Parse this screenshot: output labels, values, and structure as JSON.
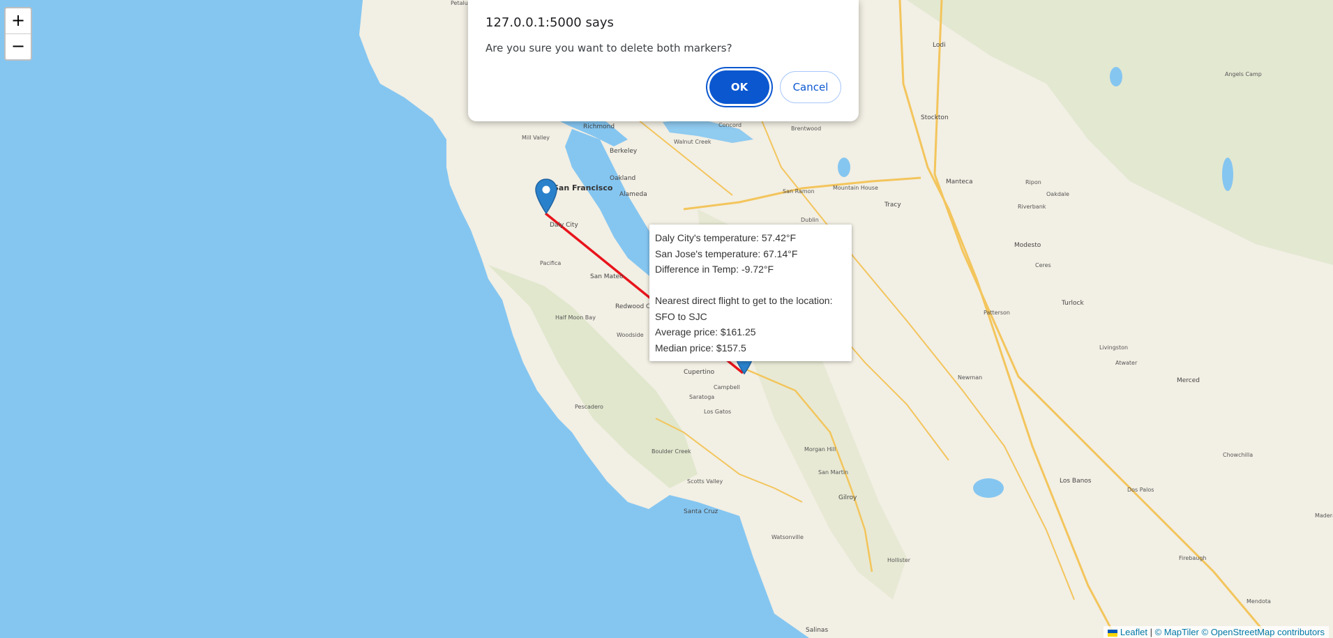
{
  "dialog": {
    "title": "127.0.0.1:5000 says",
    "message": "Are you sure you want to delete both markers?",
    "ok_label": "OK",
    "cancel_label": "Cancel"
  },
  "zoom": {
    "in_label": "+",
    "out_label": "−"
  },
  "popup": {
    "lines": [
      "Daly City's temperature: 57.42°F",
      "San Jose's temperature: 67.14°F",
      "Difference in Temp: -9.72°F",
      "",
      "Nearest direct flight to get to the location:",
      "SFO to SJC",
      "Average price: $161.25",
      "Median price: $157.5"
    ]
  },
  "attribution": {
    "leaflet": "Leaflet",
    "separator": "|",
    "maptiler": "© MapTiler",
    "osm": "© OpenStreetMap contributors"
  },
  "places": {
    "petaluma": "Petaluma Creek",
    "lodi": "Lodi",
    "stockton": "Stockton",
    "richmond": "Richmond",
    "berkeley": "Berkeley",
    "oakland": "Oakland",
    "alameda": "Alameda",
    "san_francisco": "San Francisco",
    "daly_city": "Daly City",
    "pacifica": "Pacifica",
    "san_mateo": "San Mateo",
    "redwood_city": "Redwood City",
    "half_moon_bay": "Half Moon Bay",
    "cupertino": "Cupertino",
    "campbell": "Campbell",
    "saratoga": "Saratoga",
    "los_gatos": "Los Gatos",
    "tracy": "Tracy",
    "manteca": "Manteca",
    "modesto": "Modesto",
    "turlock": "Turlock",
    "merced": "Merced",
    "los_banos": "Los Banos",
    "gilroy": "Gilroy",
    "morgan_hill": "Morgan Hill",
    "santa_cruz": "Santa Cruz",
    "watsonville": "Watsonville",
    "hollister": "Hollister",
    "salinas": "Salinas",
    "livermore": "Dublin",
    "walnut_creek": "Walnut Creek",
    "san_ramon": "San Ramon",
    "mountain_house": "Mountain House",
    "patterson": "Patterson",
    "newman": "Newman",
    "chowchilla": "Chowchilla",
    "madera": "Madera",
    "angels_camp": "Angels Camp",
    "oakdale": "Oakdale",
    "riverbank": "Riverbank",
    "ripon": "Ripon",
    "ceres": "Ceres",
    "atwater": "Atwater",
    "livingston": "Livingston",
    "pescadero": "Pescadero",
    "boulder_creek": "Boulder Creek",
    "scotts_valley": "Scotts Valley",
    "san_martin": "San Martin",
    "firebaugh": "Firebaugh",
    "dos_palos": "Dos Palos",
    "mill_valley": "Mill Valley",
    "concord": "Concord",
    "brentwood": "Brentwood",
    "woodside": "Woodside",
    "mendota": "Mendota"
  },
  "colors": {
    "water": "#85c6f1",
    "land": "#f2efe4",
    "route_line": "#e8141b",
    "marker": "#2a81cb",
    "dialog_primary": "#0b57d0"
  },
  "icons": {
    "marker": "map-marker-icon",
    "flag": "ukraine-flag-icon"
  }
}
